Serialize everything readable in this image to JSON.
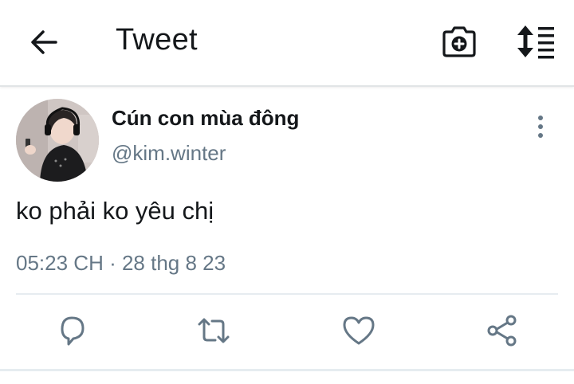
{
  "header": {
    "title": "Tweet",
    "icons": {
      "back": "arrow-left-icon",
      "camera": "camera-plus-icon",
      "sort": "sort-list-icon"
    }
  },
  "tweet": {
    "display_name": "Cún con mùa đông",
    "handle": "@kim.winter",
    "text": "ko phải ko yêu chị",
    "timestamp": "05:23 CH · 28 thg 8 23"
  },
  "actions": {
    "icons": [
      "reply-icon",
      "retweet-icon",
      "like-icon",
      "share-icon"
    ]
  },
  "colors": {
    "text_primary": "#14171a",
    "text_secondary": "#657786",
    "icon_action": "#657786",
    "divider": "#e6ecf0"
  }
}
